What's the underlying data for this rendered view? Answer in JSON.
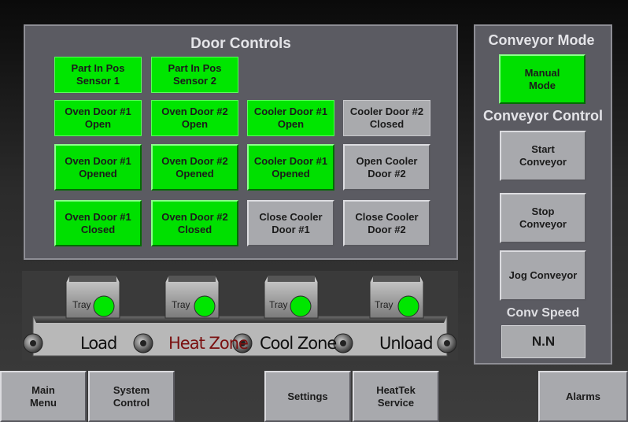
{
  "door_controls": {
    "title": "Door Controls",
    "part_sensor_1": "Part In Pos\nSensor 1",
    "part_sensor_2": "Part In Pos\nSensor 2",
    "oven_door_1_open": "Oven Door #1\nOpen",
    "oven_door_2_open": "Oven Door #2\nOpen",
    "cooler_door_1_open": "Cooler Door #1\nOpen",
    "cooler_door_2_closed": "Cooler Door #2\nClosed",
    "oven_door_1_opened": "Oven Door #1\nOpened",
    "oven_door_2_opened": "Oven Door #2\nOpened",
    "cooler_door_1_opened": "Cooler Door #1\nOpened",
    "open_cooler_door_2": "Open Cooler\nDoor #2",
    "oven_door_1_closed": "Oven Door #1\nClosed",
    "oven_door_2_closed": "Oven Door #2\nClosed",
    "close_cooler_door_1": "Close Cooler\nDoor #1",
    "close_cooler_door_2": "Close Cooler\nDoor #2"
  },
  "conveyor": {
    "tray_label": "Tray",
    "zones": [
      "Load",
      "Heat Zone",
      "Cool Zone",
      "Unload"
    ],
    "heat_zone_color": "#7a1010",
    "tray_indicator_color": "#00e600"
  },
  "conveyor_mode": {
    "title": "Conveyor Mode",
    "manual_mode": "Manual\nMode"
  },
  "conveyor_control": {
    "title": "Conveyor Control",
    "start": "Start\nConveyor",
    "stop": "Stop\nConveyor",
    "jog": "Jog Conveyor",
    "speed_label": "Conv Speed",
    "speed_value": "N.N"
  },
  "nav": {
    "main_menu": "Main\nMenu",
    "system_control": "System\nControl",
    "settings": "Settings",
    "heattek_service": "HeatTek\nService",
    "alarms": "Alarms"
  },
  "colors": {
    "active_green": "#00e600",
    "inactive_gray": "#a9aaad",
    "panel_gray": "#5b5b62"
  }
}
